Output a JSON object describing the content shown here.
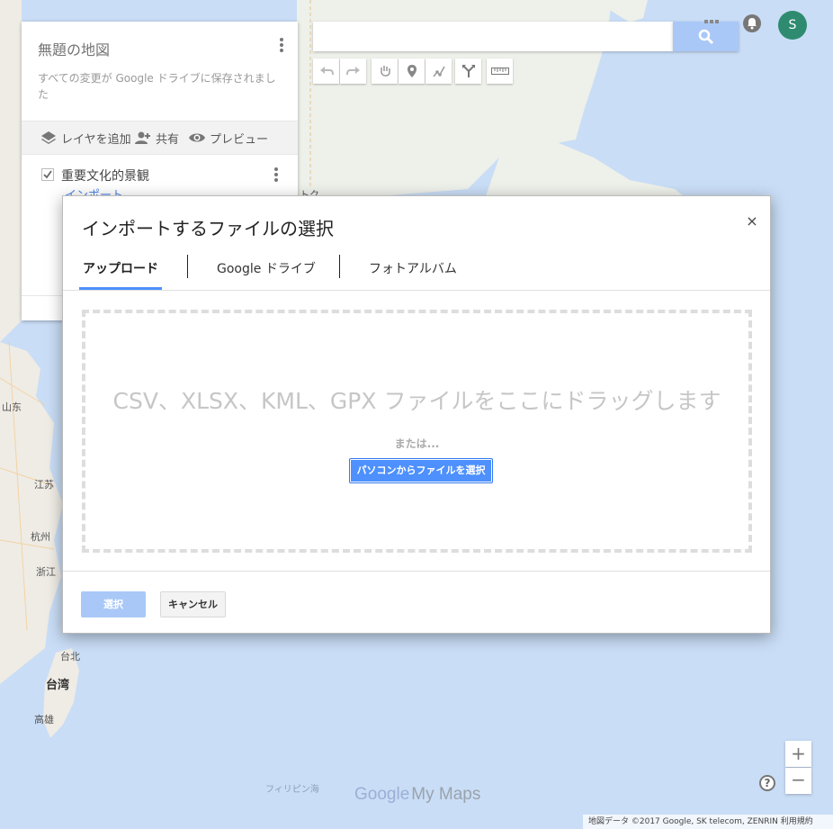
{
  "panel": {
    "title": "無題の地図",
    "save_status": "すべての変更が Google ドライブに保存されました",
    "add_layer": "レイヤを追加",
    "share": "共有",
    "preview": "プレビュー",
    "layer_name": "重要文化的景観",
    "import_link": "インポート"
  },
  "search": {
    "value": "",
    "placeholder": ""
  },
  "toolbar": {
    "tools": [
      "undo-icon",
      "redo-icon",
      "pan-hand-icon",
      "marker-icon",
      "draw-line-icon",
      "directions-icon",
      "ruler-icon"
    ]
  },
  "account": {
    "avatar_initial": "S"
  },
  "dialog": {
    "title": "インポートするファイルの選択",
    "close": "×",
    "tabs": [
      "アップロード",
      "Google ドライブ",
      "フォトアルバム"
    ],
    "active_tab": "アップロード",
    "drop_text": "CSV、XLSX、KML、GPX ファイルをここにドラッグします",
    "or_text": "または...",
    "choose_file_button": "パソコンからファイルを選択",
    "select_button": "選択",
    "cancel_button": "キャンセル"
  },
  "map": {
    "labels": {
      "shandong": "山东",
      "jiangsu": "江苏",
      "hangzhou": "杭州",
      "zhejiang": "浙江",
      "taipei": "台北",
      "taiwan": "台湾",
      "kaohsiung": "高雄",
      "philippine_sea": "フィリピン海",
      "partial": "トク"
    },
    "zoom_in": "+",
    "zoom_out": "−",
    "help": "?",
    "logo_google": "Google",
    "logo_mymaps": "My Maps",
    "attribution": "地図データ ©2017 Google, SK telecom, ZENRIN    利用規約"
  },
  "colors": {
    "accent": "#4d90fe",
    "search_button": "#a9c8f7",
    "sea": "#c9ddf6",
    "land": "#f1eee8",
    "avatar": "#2e8b6f"
  }
}
